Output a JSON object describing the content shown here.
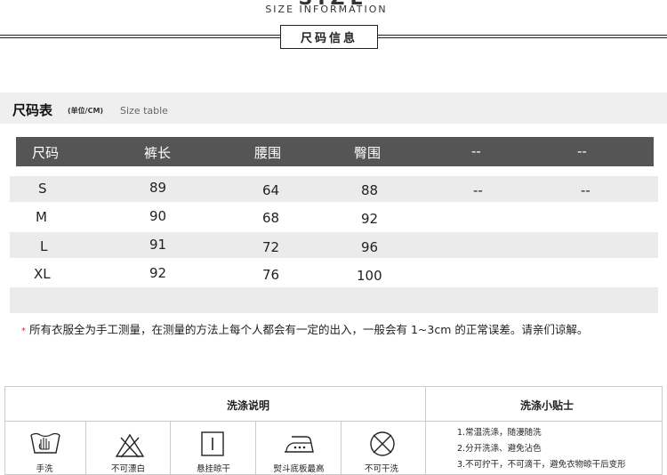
{
  "header": {
    "title_partial": "SIZE",
    "subtitle": "SIZE INFORMATION",
    "badge": "尺码信息"
  },
  "size_table": {
    "title": "尺码表",
    "unit": "(单位/CM)",
    "title_en": "Size table",
    "columns": [
      "尺码",
      "裤长",
      "腰围",
      "臀围",
      "--",
      "--"
    ],
    "rows": [
      [
        "S",
        "89",
        "64",
        "88",
        "--",
        "--"
      ],
      [
        "M",
        "90",
        "68",
        "92",
        "",
        ""
      ],
      [
        "L",
        "91",
        "72",
        "96",
        "",
        ""
      ],
      [
        "XL",
        "92",
        "76",
        "100",
        "",
        ""
      ]
    ]
  },
  "note": {
    "star": "*",
    "text": "所有衣服全为手工测量，在测量的方法上每个人都会有一定的出入，一般会有 1~3cm 的正常误差。请亲们谅解。"
  },
  "care": {
    "instructions_title": "洗涤说明",
    "tips_title": "洗涤小贴士",
    "icons": [
      {
        "icon": "hand-wash-icon",
        "label": "手洗"
      },
      {
        "icon": "no-bleach-icon",
        "label": "不可漂白"
      },
      {
        "icon": "hang-dry-icon",
        "label": "悬挂晾干"
      },
      {
        "icon": "iron-icon",
        "label": "熨斗底板最高"
      },
      {
        "icon": "no-tumble-dry-icon",
        "label": "不可干洗"
      }
    ],
    "tips": [
      "1.常温洗涤，随漫随洗",
      "2.分开洗涤、避免沾色",
      "3.不可拧干，不可滴干，避免衣物晾干后变形"
    ]
  }
}
